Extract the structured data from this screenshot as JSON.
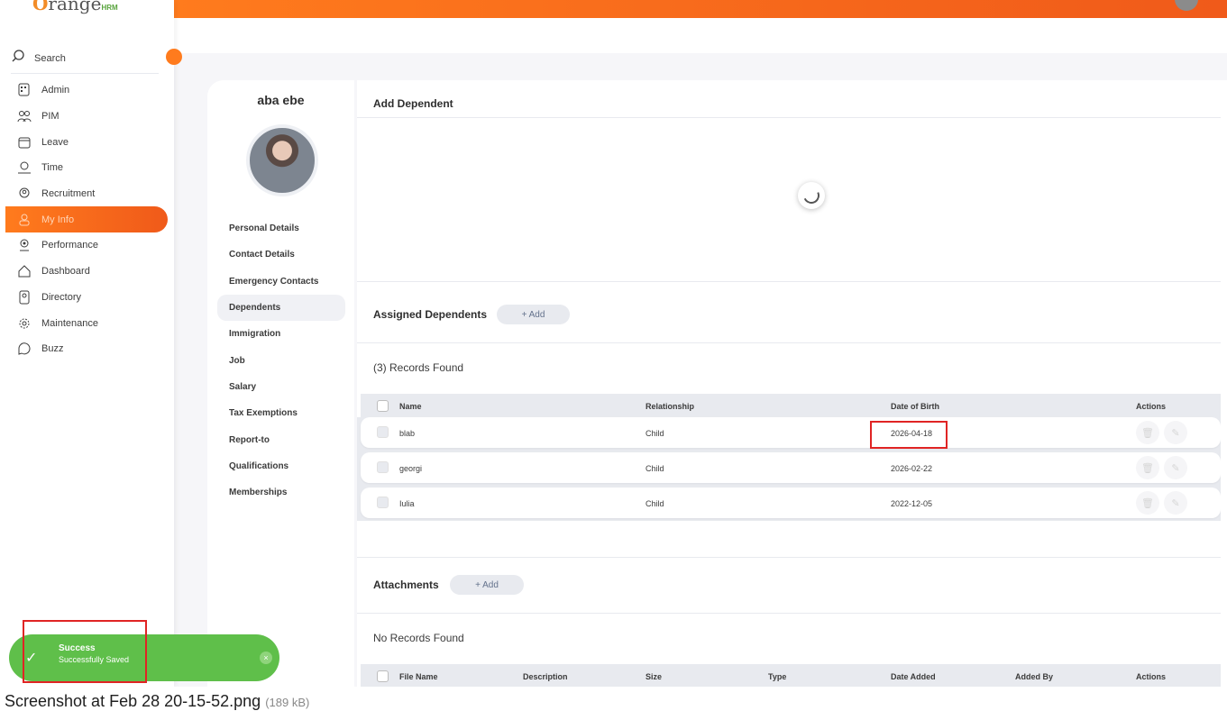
{
  "app": {
    "logo_text": "range",
    "logo_sub": "HRM"
  },
  "sidebar": {
    "search_label": "Search",
    "items": [
      {
        "label": "Admin",
        "icon": "admin-icon"
      },
      {
        "label": "PIM",
        "icon": "pim-icon"
      },
      {
        "label": "Leave",
        "icon": "leave-icon"
      },
      {
        "label": "Time",
        "icon": "time-icon"
      },
      {
        "label": "Recruitment",
        "icon": "recruitment-icon"
      },
      {
        "label": "My Info",
        "icon": "myinfo-icon"
      },
      {
        "label": "Performance",
        "icon": "performance-icon"
      },
      {
        "label": "Dashboard",
        "icon": "dashboard-icon"
      },
      {
        "label": "Directory",
        "icon": "directory-icon"
      },
      {
        "label": "Maintenance",
        "icon": "maintenance-icon"
      },
      {
        "label": "Buzz",
        "icon": "buzz-icon"
      }
    ],
    "active": "My Info"
  },
  "profile": {
    "name": "aba ebe",
    "nav": [
      "Personal Details",
      "Contact Details",
      "Emergency Contacts",
      "Dependents",
      "Immigration",
      "Job",
      "Salary",
      "Tax Exemptions",
      "Report-to",
      "Qualifications",
      "Memberships"
    ],
    "selected": "Dependents"
  },
  "add_dependent": {
    "title": "Add Dependent"
  },
  "assigned": {
    "title": "Assigned Dependents",
    "add_label": "+ Add",
    "records_found": "(3) Records Found",
    "columns": [
      "Name",
      "Relationship",
      "Date of Birth",
      "Actions"
    ],
    "rows": [
      {
        "name": "blab",
        "relationship": "Child",
        "dob": "2026-04-18"
      },
      {
        "name": "georgi",
        "relationship": "Child",
        "dob": "2026-02-22"
      },
      {
        "name": "Iulia",
        "relationship": "Child",
        "dob": "2022-12-05"
      }
    ]
  },
  "attachments": {
    "title": "Attachments",
    "add_label": "+ Add",
    "records_found": "No Records Found",
    "columns": [
      "File Name",
      "Description",
      "Size",
      "Type",
      "Date Added",
      "Added By",
      "Actions"
    ]
  },
  "toast": {
    "title": "Success",
    "message": "Successfully Saved",
    "close": "×"
  },
  "caption": {
    "filename": "Screenshot at Feb 28 20-15-52.png",
    "size": "(189 kB)"
  },
  "colors": {
    "accent": "#ff7b1d",
    "success": "#5fbf4a",
    "highlight": "#e02424"
  }
}
